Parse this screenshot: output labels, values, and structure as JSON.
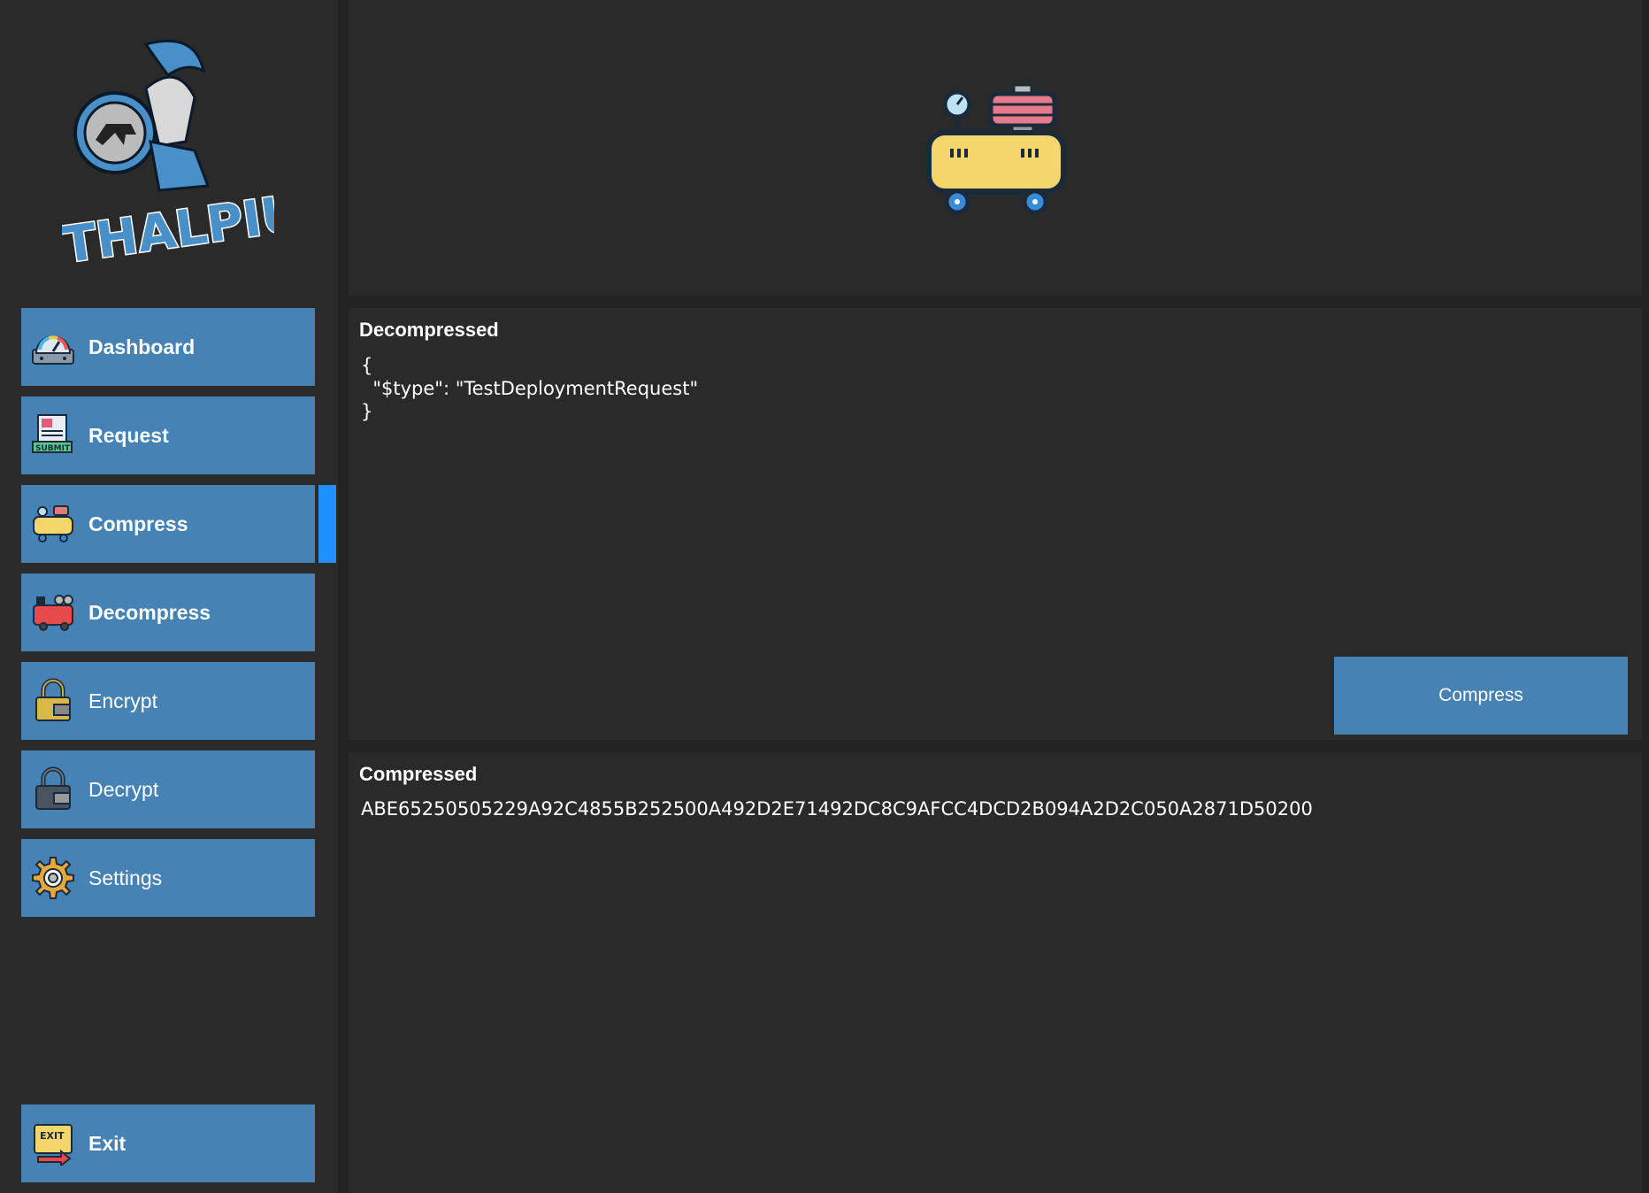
{
  "app": {
    "logo_text": "THALPIUS"
  },
  "sidebar": {
    "items": [
      {
        "label": "Dashboard",
        "icon": "gauge-icon"
      },
      {
        "label": "Request",
        "icon": "submit-form-icon"
      },
      {
        "label": "Compress",
        "icon": "air-compressor-icon",
        "active": true
      },
      {
        "label": "Decompress",
        "icon": "red-compressor-icon"
      },
      {
        "label": "Encrypt",
        "icon": "padlock-icon"
      },
      {
        "label": "Decrypt",
        "icon": "dark-padlock-icon"
      },
      {
        "label": "Settings",
        "icon": "gear-icon"
      }
    ],
    "exit_label": "Exit"
  },
  "decompressed": {
    "title": "Decompressed",
    "content": "{\n  \"$type\": \"TestDeploymentRequest\"\n}"
  },
  "compress_button": {
    "label": "Compress"
  },
  "compressed": {
    "title": "Compressed",
    "value": "ABE65250505229A92C4855B252500A492D2E71492DC8C9AFCC4DCD2B094A2D2C050A2871D50200"
  },
  "colors": {
    "accent": "#4682b4",
    "active_indicator": "#1e90ff",
    "panel": "#2a2a2a",
    "background": "#222222"
  }
}
